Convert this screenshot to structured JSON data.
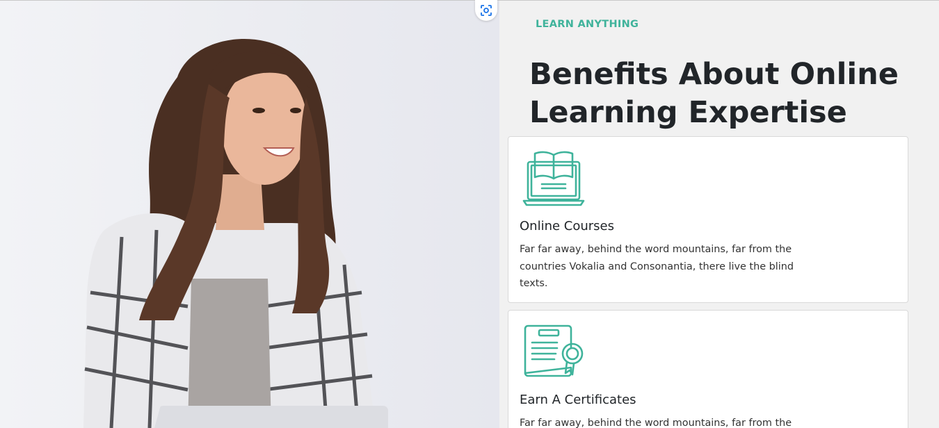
{
  "hero": {
    "image_alt": "Smiling woman in plaid shirt with laptop"
  },
  "section": {
    "eyebrow": "LEARN ANYTHING",
    "heading": "Benefits About Online Learning Expertise"
  },
  "cards": [
    {
      "icon": "book-laptop-icon",
      "title": "Online Courses",
      "text": "Far far away, behind the word mountains, far from the countries Vokalia and Consonantia, there live the blind texts."
    },
    {
      "icon": "certificate-icon",
      "title": "Earn A Certificates",
      "text": "Far far away, behind the word mountains, far from the"
    }
  ],
  "colors": {
    "accent": "#3fb39b",
    "heading": "#212529",
    "scan_icon": "#1a73e8"
  }
}
